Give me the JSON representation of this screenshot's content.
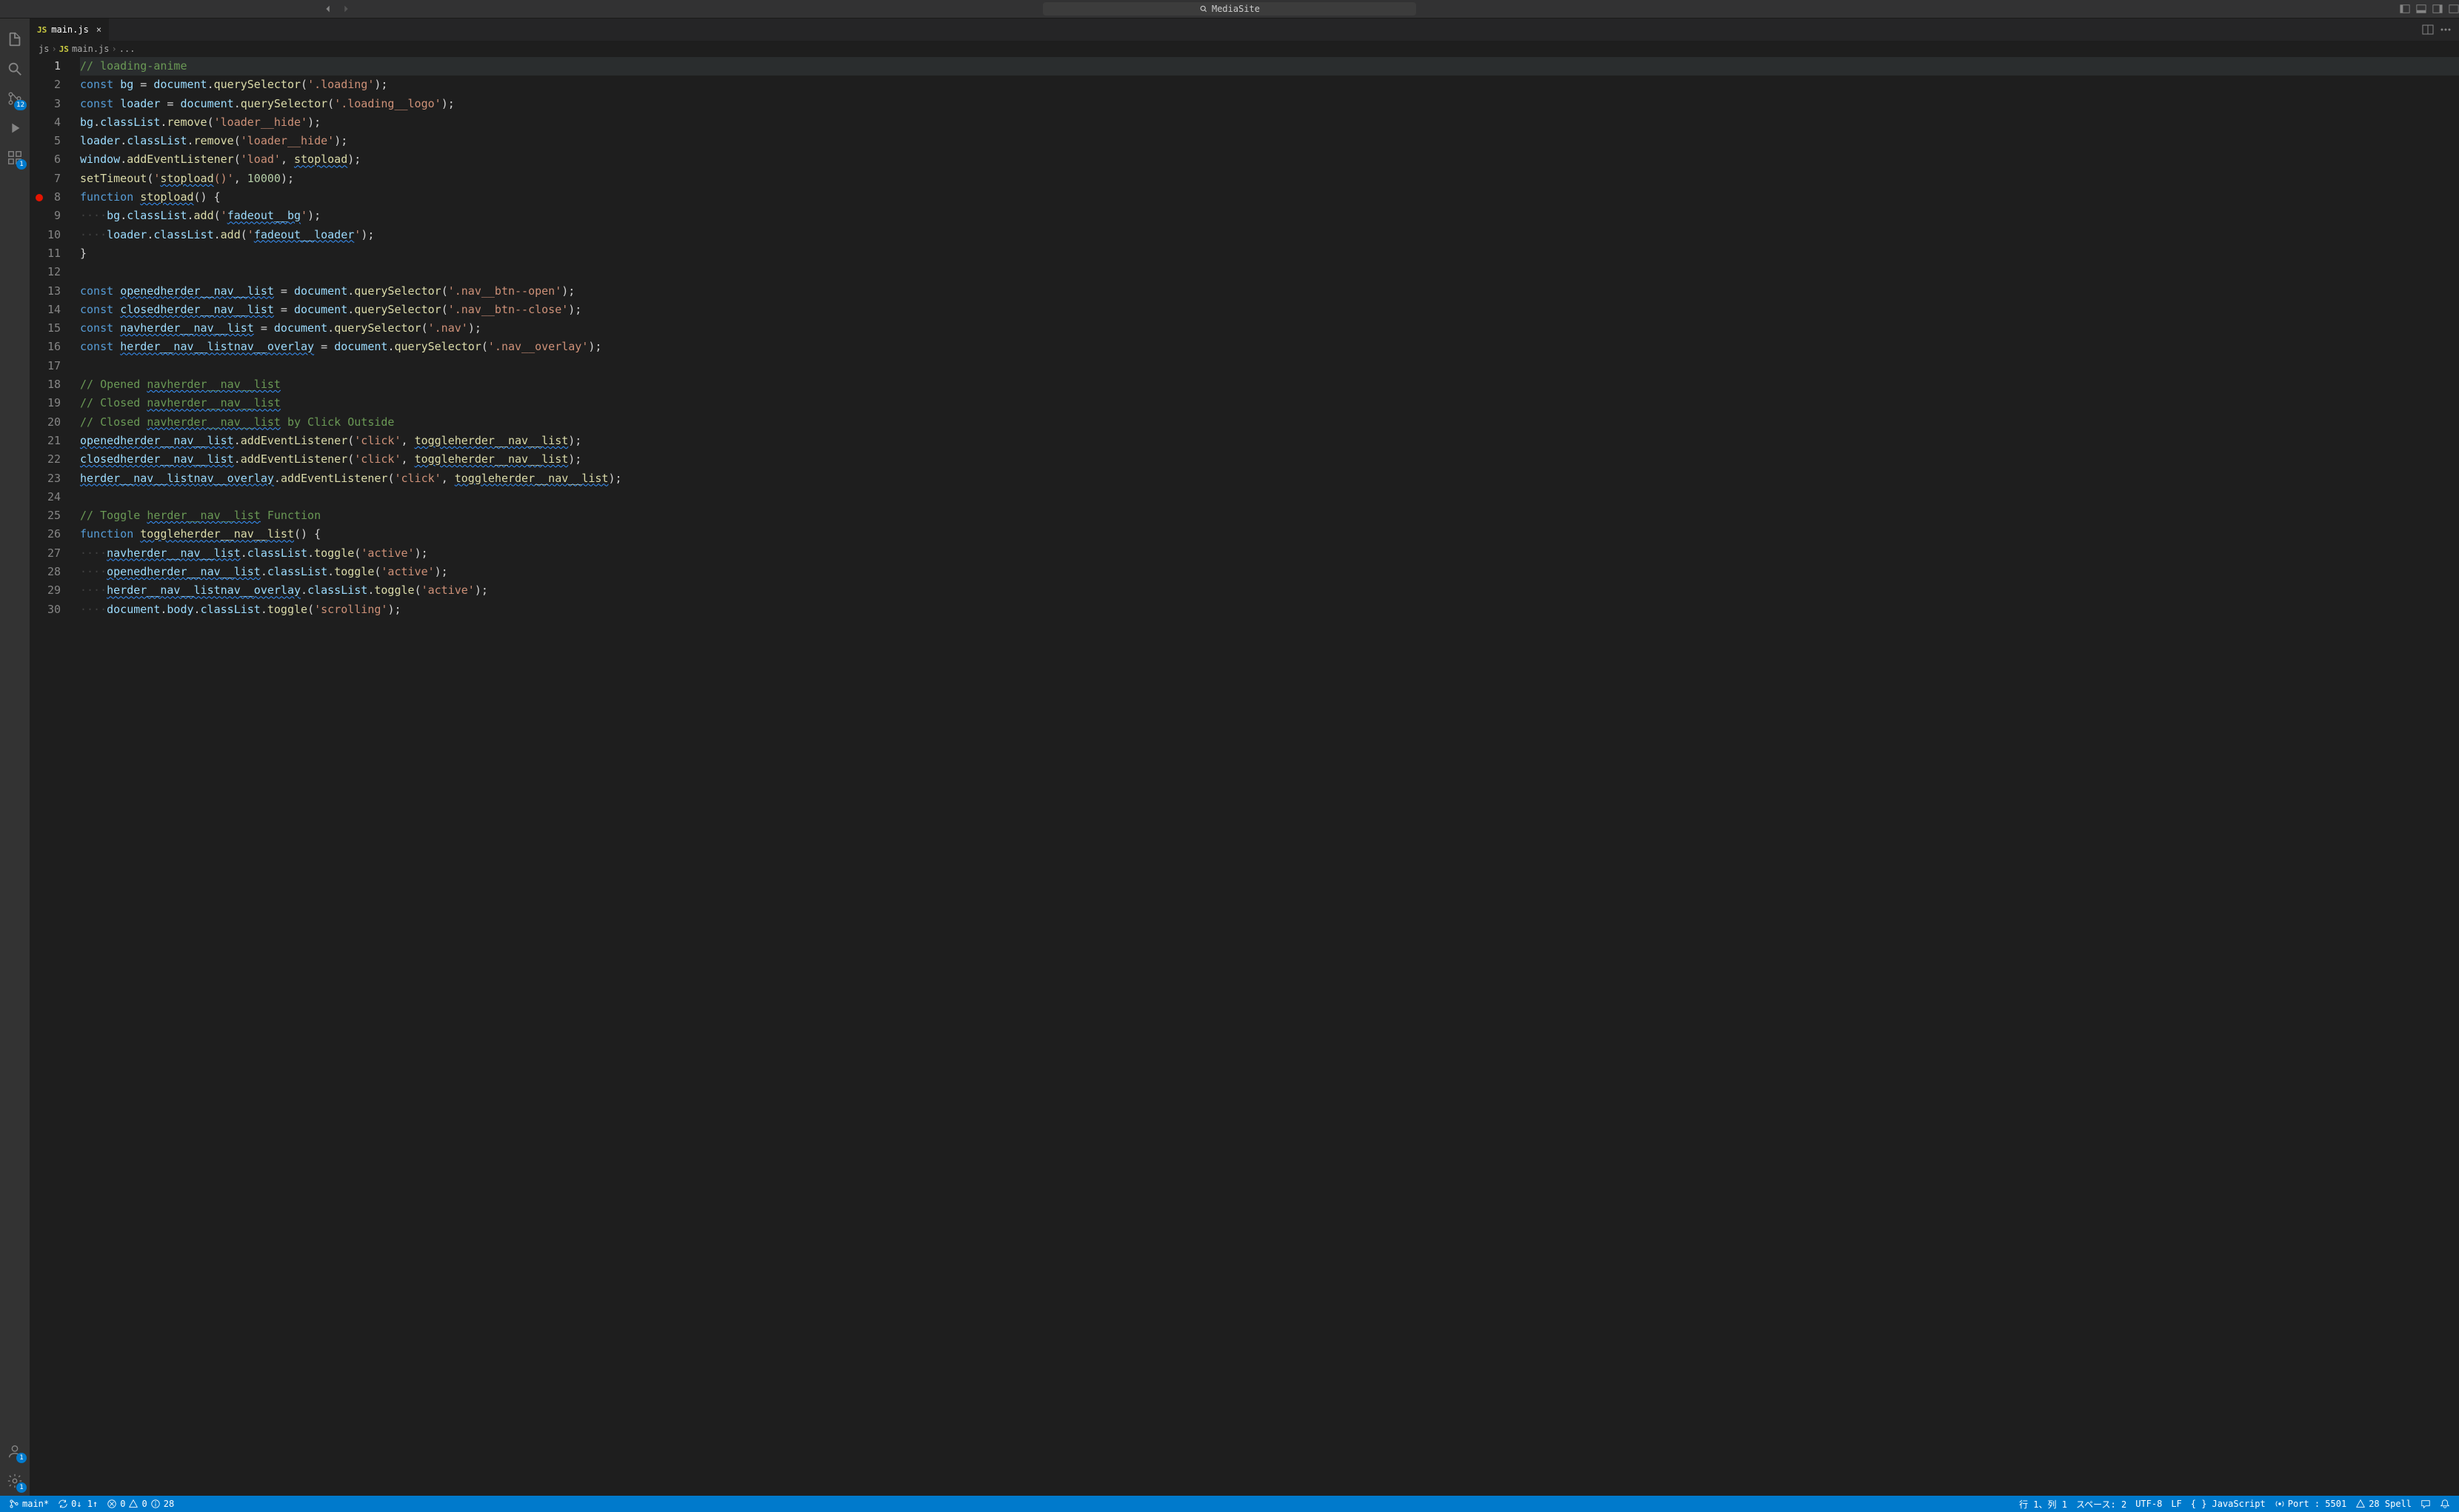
{
  "titlebar": {
    "search_label": "MediaSite"
  },
  "activitybar": {
    "badges": {
      "scm": "12",
      "extensions": "1",
      "accounts": "1",
      "settings": "1"
    }
  },
  "tab": {
    "filename": "main.js",
    "icon_text": "JS"
  },
  "breadcrumbs": {
    "p0": "js",
    "p1_icon": "JS",
    "p1": "main.js",
    "p2": "..."
  },
  "code": {
    "line_count": 30,
    "lines": [
      "// loading-anime",
      "const bg = document.querySelector('.loading');",
      "const loader = document.querySelector('.loading__logo');",
      "bg.classList.remove('loader__hide');",
      "loader.classList.remove('loader__hide');",
      "window.addEventListener('load', stopload);",
      "setTimeout('stopload()', 10000);",
      "function stopload() {",
      "    bg.classList.add('fadeout__bg');",
      "    loader.classList.add('fadeout__loader');",
      "}",
      "",
      "const openedherder__nav__list = document.querySelector('.nav__btn--open');",
      "const closedherder__nav__list = document.querySelector('.nav__btn--close');",
      "const navherder__nav__list = document.querySelector('.nav');",
      "const herder__nav__listnav__overlay = document.querySelector('.nav__overlay');",
      "",
      "// Opened navherder__nav__list",
      "// Closed navherder__nav__list",
      "// Closed navherder__nav__list by Click Outside",
      "openedherder__nav__list.addEventListener('click', toggleherder__nav__list);",
      "closedherder__nav__list.addEventListener('click', toggleherder__nav__list);",
      "herder__nav__listnav__overlay.addEventListener('click', toggleherder__nav__list);",
      "",
      "// Toggle herder__nav__list Function",
      "function toggleherder__nav__list() {",
      "    navherder__nav__list.classList.toggle('active');",
      "    openedherder__nav__list.classList.toggle('active');",
      "    herder__nav__listnav__overlay.classList.toggle('active');",
      "    document.body.classList.toggle('scrolling');"
    ]
  },
  "statusbar": {
    "branch": "main*",
    "sync": "0↓ 1↑",
    "errors": "0",
    "warnings": "0",
    "infos": "28",
    "position": "行 1、列 1",
    "spaces": "スペース: 2",
    "encoding": "UTF-8",
    "eol": "LF",
    "language": "JavaScript",
    "port": "Port : 5501",
    "spell": "28 Spell"
  }
}
